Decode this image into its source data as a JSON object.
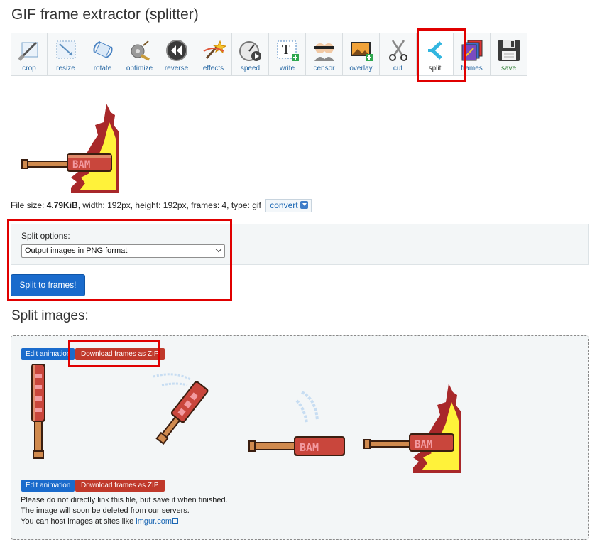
{
  "page": {
    "title": "GIF frame extractor (splitter)"
  },
  "toolbar": {
    "tools": [
      {
        "label": "crop",
        "icon": "crop-icon"
      },
      {
        "label": "resize",
        "icon": "resize-icon"
      },
      {
        "label": "rotate",
        "icon": "rotate-icon"
      },
      {
        "label": "optimize",
        "icon": "optimize-icon"
      },
      {
        "label": "reverse",
        "icon": "reverse-icon"
      },
      {
        "label": "effects",
        "icon": "effects-icon"
      },
      {
        "label": "speed",
        "icon": "speed-icon"
      },
      {
        "label": "write",
        "icon": "write-icon"
      },
      {
        "label": "censor",
        "icon": "censor-icon"
      },
      {
        "label": "overlay",
        "icon": "overlay-icon"
      },
      {
        "label": "cut",
        "icon": "scissors-icon"
      },
      {
        "label": "split",
        "icon": "split-icon"
      },
      {
        "label": "frames",
        "icon": "frames-icon"
      },
      {
        "label": "save",
        "icon": "save-icon"
      }
    ],
    "active": "split"
  },
  "file_info": {
    "prefix": "File size: ",
    "size": "4.79KiB",
    "details": ", width: 192px, height: 192px, frames: 4, type: gif",
    "convert_label": "convert"
  },
  "options": {
    "label": "Split options:",
    "format_value": "Output images in PNG format",
    "submit_label": "Split to frames!"
  },
  "results": {
    "title": "Split images:",
    "edit_label": "Edit animation",
    "zip_label": "Download frames as ZIP",
    "notice_line1": "Please do not directly link this file, but save it when finished.",
    "notice_line2": "The image will soon be deleted from our servers.",
    "notice_line3_prefix": "You can host images at sites like ",
    "notice_link": "imgur.com",
    "frame_text": "BAM"
  },
  "colors": {
    "accent_blue": "#1a6bcc",
    "zip_red": "#c0392b",
    "highlight_red": "#e00000"
  }
}
